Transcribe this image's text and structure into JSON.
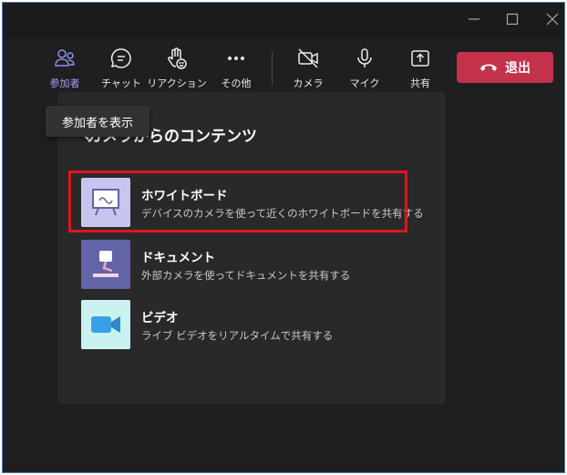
{
  "window": {
    "controls": [
      "minimize",
      "maximize",
      "close"
    ]
  },
  "toolbar": {
    "participants_label": "参加者",
    "chat_label": "チャット",
    "reaction_label": "リアクション",
    "more_label": "その他",
    "camera_label": "カメラ",
    "mic_label": "マイク",
    "share_label": "共有",
    "leave_label": "退出",
    "leave_color": "#c4314b",
    "active_color": "#8e8ef0"
  },
  "tooltip": {
    "text": "参加者を表示"
  },
  "panel": {
    "title": "カメラからのコンテンツ",
    "options": [
      {
        "title": "ホワイトボード",
        "desc": "デバイスのカメラを使って近くのホワイトボードを共有する",
        "icon": "whiteboard-icon",
        "thumb_color": "#c7c4ee"
      },
      {
        "title": "ドキュメント",
        "desc": "外部カメラを使ってドキュメントを共有する",
        "icon": "document-camera-icon",
        "thumb_color": "#6264a7"
      },
      {
        "title": "ビデオ",
        "desc": "ライブ ビデオをリアルタイムで共有する",
        "icon": "video-camera-icon",
        "thumb_color": "#c9f3f1"
      }
    ],
    "highlight_color": "#e1141c"
  }
}
